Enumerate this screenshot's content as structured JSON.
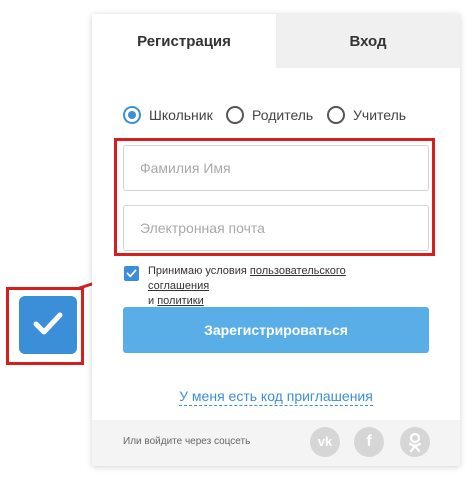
{
  "tabs": {
    "register_label": "Регистрация",
    "login_label": "Вход"
  },
  "roles": [
    {
      "label": "Школьник",
      "checked": true
    },
    {
      "label": "Родитель",
      "checked": false
    },
    {
      "label": "Учитель",
      "checked": false
    }
  ],
  "fields": {
    "name_placeholder": "Фамилия Имя",
    "email_placeholder": "Электронная почта"
  },
  "agreement": {
    "checked": true,
    "prefix": "Принимаю условия ",
    "terms_link": "пользовательского соглашения",
    "middle": "и ",
    "policy_link": "политики"
  },
  "register_button": "Зарегистрироваться",
  "invite_link": "У меня есть код приглашения",
  "footer": {
    "label": "Или войдите через соцсеть",
    "socials": [
      {
        "icon": "vk-icon",
        "glyph": "vk"
      },
      {
        "icon": "facebook-icon",
        "glyph": "f"
      },
      {
        "icon": "odnoklassniki-icon",
        "glyph": "ok"
      }
    ]
  },
  "colors": {
    "accent": "#3b8fd8",
    "button": "#5aaee8",
    "highlight": "#d41f1f"
  }
}
